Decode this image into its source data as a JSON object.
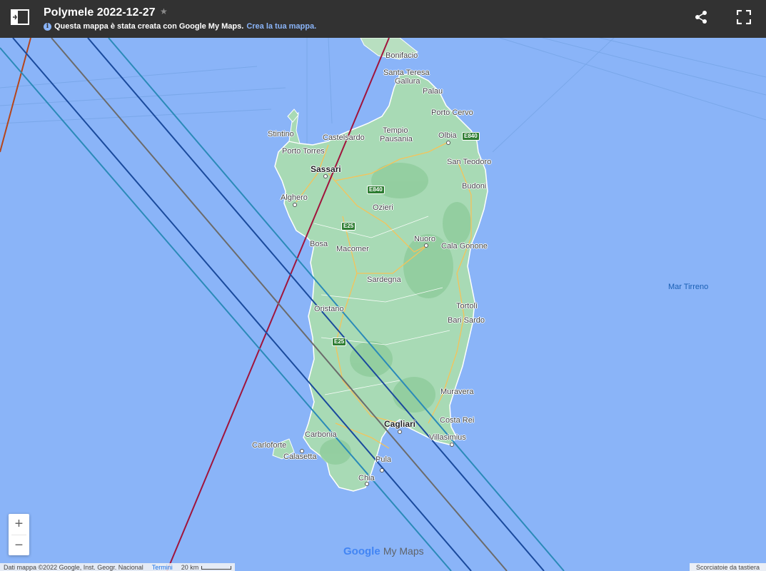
{
  "header": {
    "title": "Polymele 2022-12-27",
    "notice": "Questa mappa è stata creata con Google My Maps.",
    "create_link": "Crea la tua mappa."
  },
  "map": {
    "places": {
      "bonifacio": "Bonifacio",
      "santa_teresa": "Santa Teresa",
      "gallura": "Gallura",
      "palau": "Palau",
      "porto_cervo": "Porto Cervo",
      "stintino": "Stintino",
      "castelsardo": "Castelsardo",
      "tempio": "Tempio",
      "pausania": "Pausania",
      "olbia": "Olbia",
      "porto_torres": "Porto Torres",
      "sassari": "Sassari",
      "san_teodoro": "San Teodoro",
      "budoni": "Budoni",
      "alghero": "Alghero",
      "ozieri": "Ozieri",
      "nuoro": "Nuoro",
      "bosa": "Bosa",
      "macomer": "Macomer",
      "cala_gonone": "Cala Gonone",
      "sardegna": "Sardegna",
      "oristano": "Oristano",
      "tortoli": "Tortolì",
      "bari_sardo": "Bari Sardo",
      "muravera": "Muravera",
      "costa_rei": "Costa Rei",
      "cagliari": "Cagliari",
      "villasimius": "Villasimius",
      "carbonia": "Carbonia",
      "carloforte": "Carloforte",
      "calasetta": "Calasetta",
      "pula": "Pula",
      "chia": "Chia"
    },
    "sea_label": "Mar Tirreno",
    "highways": {
      "e840_a": "E840",
      "e840_b": "E840",
      "e25_a": "E25",
      "e25_b": "E25"
    },
    "track_colors": [
      "#a0143c",
      "#b5451b",
      "#1a4a9c",
      "#2b8ab8",
      "#6b6b6b",
      "#1a4a9c",
      "#2b8ab8"
    ]
  },
  "controls": {
    "zoom_in": "+",
    "zoom_out": "−"
  },
  "brand": {
    "google": "Google",
    "my_maps": "My Maps"
  },
  "footer": {
    "attribution": "Dati mappa ©2022 Google, Inst. Geogr. Nacional",
    "terms": "Termini",
    "scale": "20 km",
    "shortcuts": "Scorciatoie da tastiera"
  }
}
